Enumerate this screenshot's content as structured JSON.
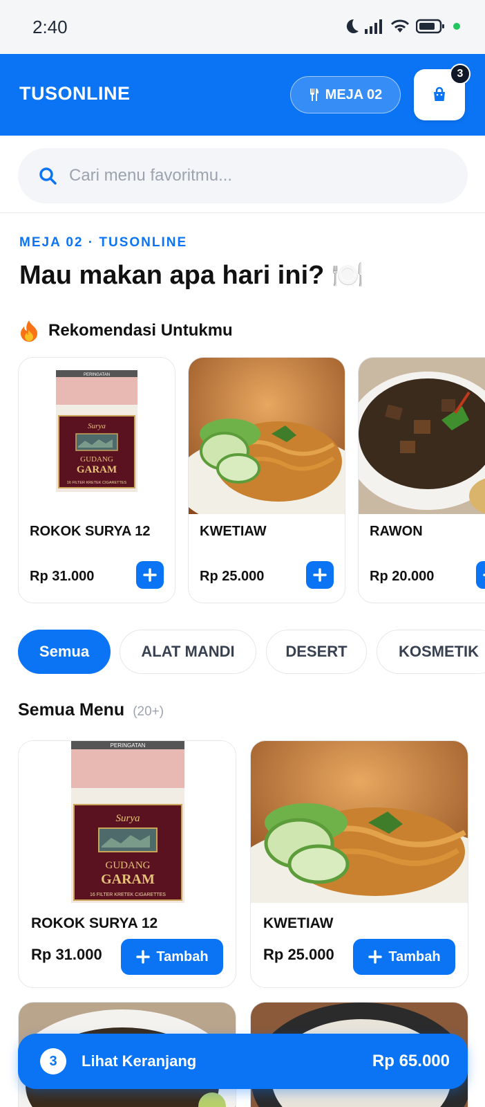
{
  "status_bar": {
    "time": "2:40"
  },
  "header": {
    "brand": "TUSONLINE",
    "table_label": "MEJA 02",
    "cart_count": "3"
  },
  "search": {
    "placeholder": "Cari menu favoritmu..."
  },
  "hero": {
    "eyebrow": "MEJA 02 · TUSONLINE",
    "title": "Mau makan apa hari ini? 🍽️"
  },
  "recommendations": {
    "title": "Rekomendasi Untukmu",
    "items": [
      {
        "name": "ROKOK SURYA 12",
        "price": "Rp 31.000"
      },
      {
        "name": "KWETIAW",
        "price": "Rp 25.000"
      },
      {
        "name": "RAWON",
        "price": "Rp 20.000"
      }
    ]
  },
  "categories": [
    "Semua",
    "ALAT MANDI",
    "DESERT",
    "KOSMETIK"
  ],
  "menu": {
    "title": "Semua Menu",
    "count": "(20+)",
    "add_label": "Tambah",
    "items": [
      {
        "name": "ROKOK SURYA 12",
        "price": "Rp 31.000"
      },
      {
        "name": "KWETIAW",
        "price": "Rp 25.000"
      }
    ]
  },
  "pack_text": {
    "warning": "PERINGATAN",
    "brand": "Surya",
    "line1": "GUDANG",
    "line2": "GARAM",
    "bottom": "16 FILTER KRETEK CIGARETTES"
  },
  "cart_bar": {
    "count": "3",
    "label": "Lihat Keranjang",
    "total": "Rp 65.000"
  },
  "colors": {
    "primary": "#0b74f5",
    "status_dot": "#22c55e"
  }
}
